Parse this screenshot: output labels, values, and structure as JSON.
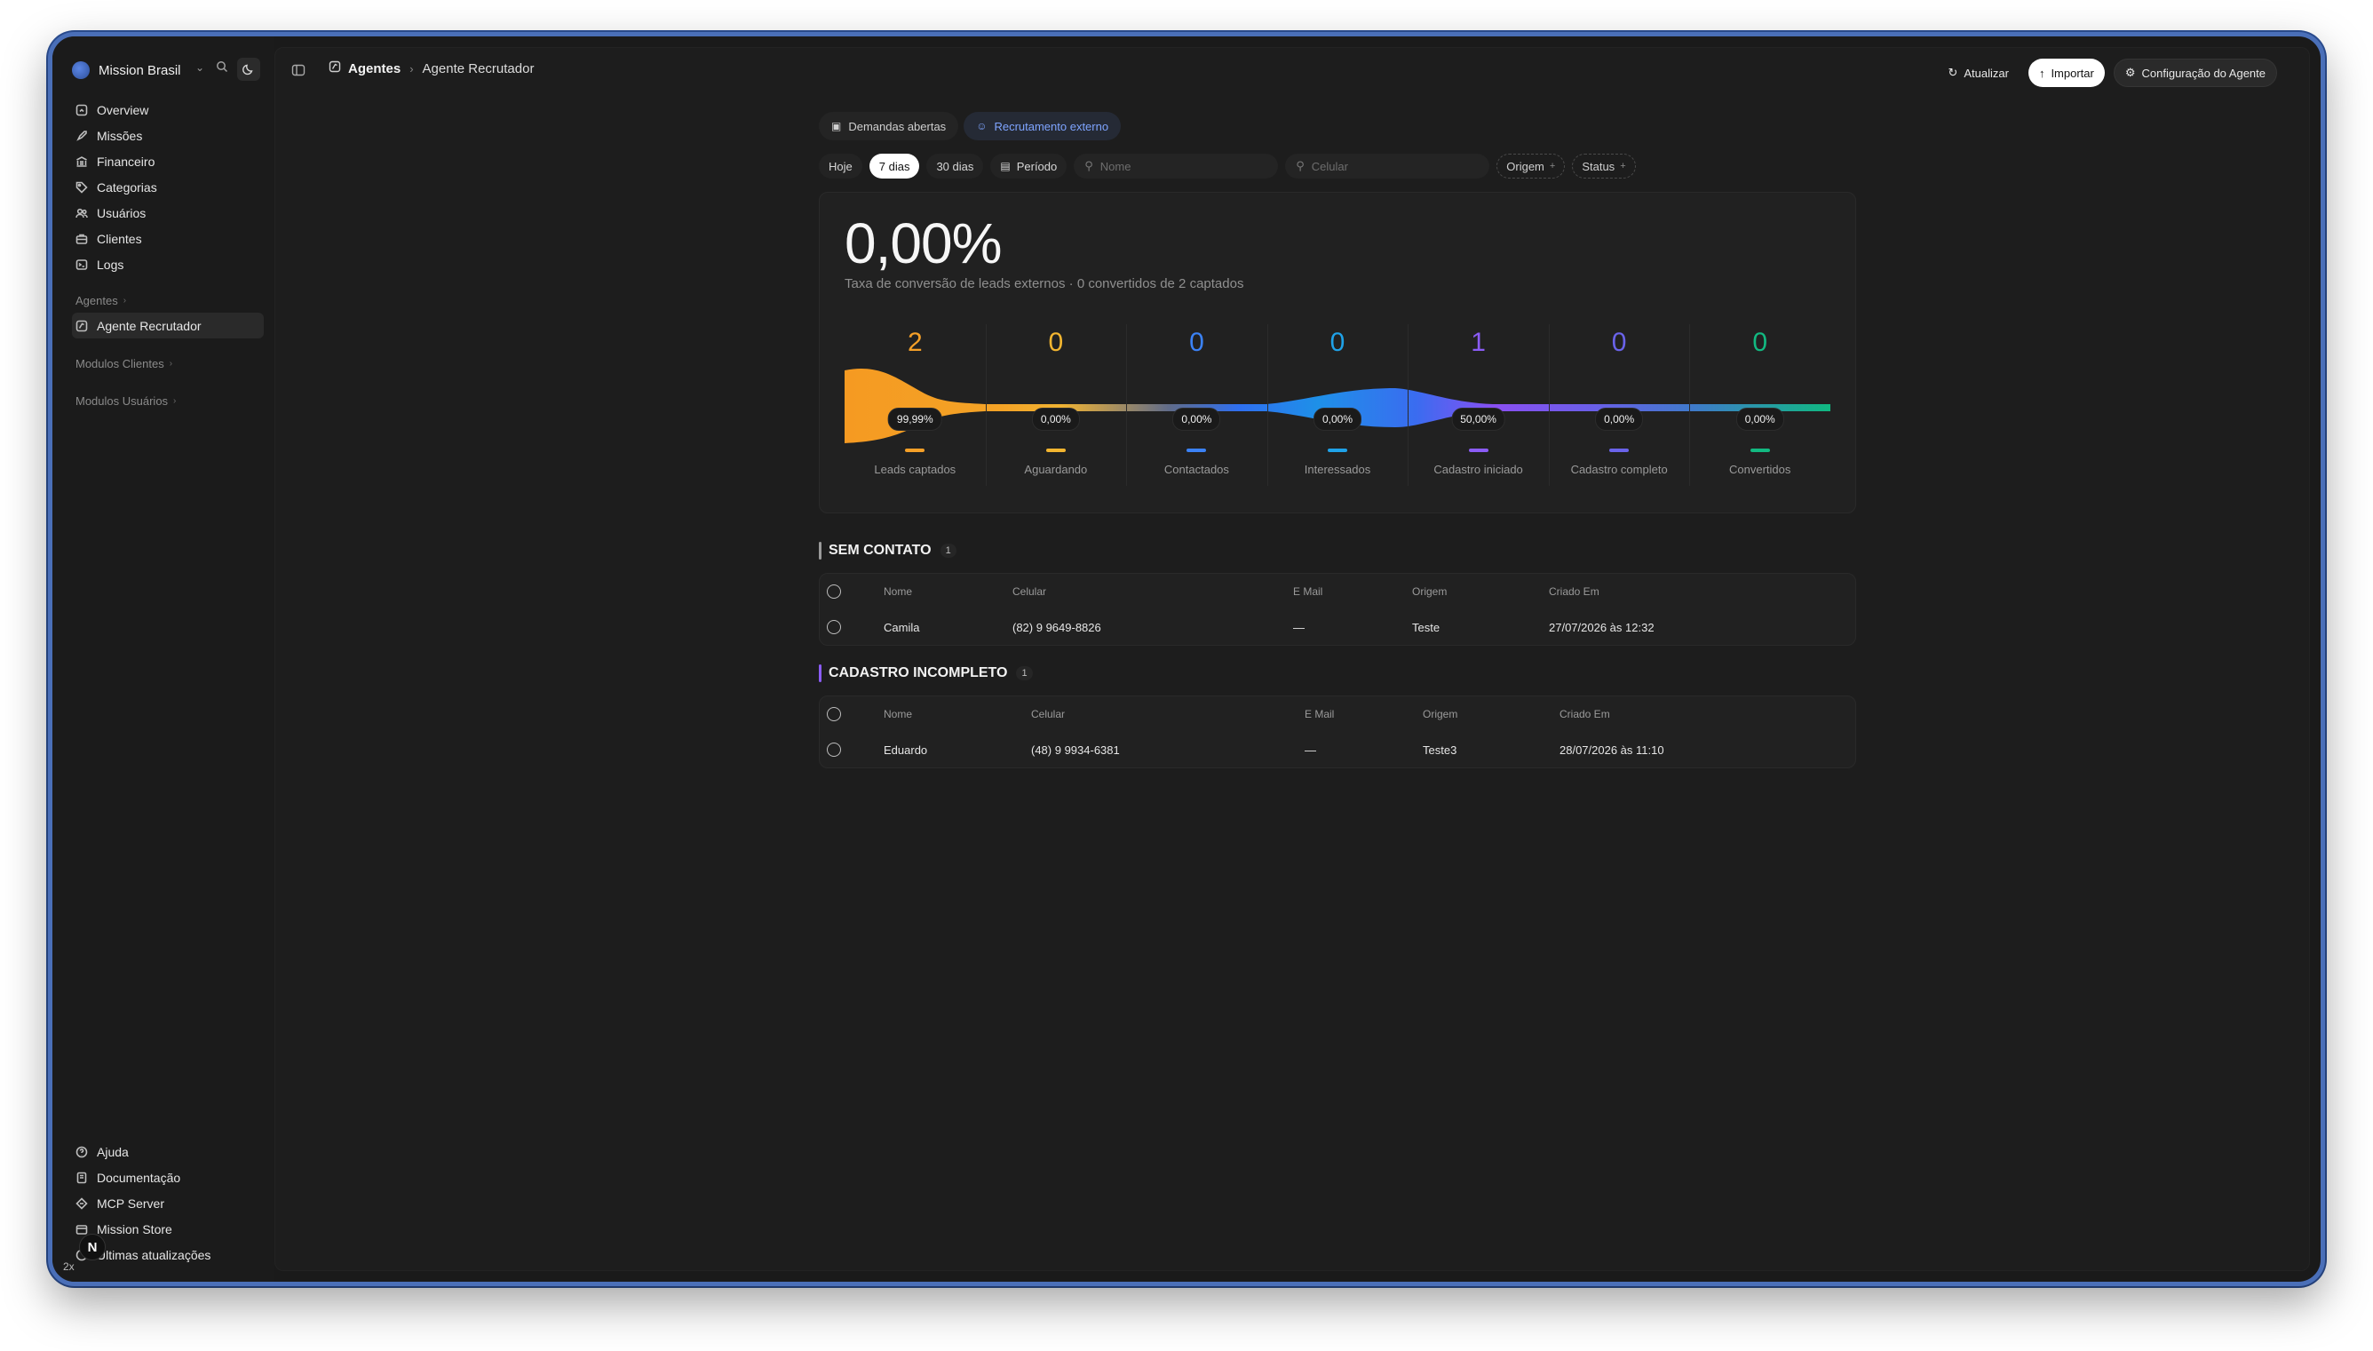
{
  "workspace": {
    "name": "Mission Brasil"
  },
  "sidebar": {
    "main_items": [
      {
        "label": "Overview",
        "icon": "overview-icon"
      },
      {
        "label": "Missões",
        "icon": "rocket-icon"
      },
      {
        "label": "Financeiro",
        "icon": "bank-icon"
      },
      {
        "label": "Categorias",
        "icon": "tag-icon"
      },
      {
        "label": "Usuários",
        "icon": "users-icon"
      },
      {
        "label": "Clientes",
        "icon": "briefcase-icon"
      },
      {
        "label": "Logs",
        "icon": "logs-icon"
      }
    ],
    "agentes_label": "Agentes",
    "agent_items": [
      {
        "label": "Agente Recrutador",
        "icon": "agent-icon"
      }
    ],
    "modulos_clientes_label": "Modulos Clientes",
    "modulos_usuarios_label": "Modulos Usuários",
    "footer_items": [
      {
        "label": "Ajuda",
        "icon": "help-icon"
      },
      {
        "label": "Documentação",
        "icon": "book-icon"
      },
      {
        "label": "MCP Server",
        "icon": "server-icon"
      },
      {
        "label": "Mission Store",
        "icon": "store-icon"
      },
      {
        "label": "Últimas atualizações",
        "icon": "updates-icon"
      }
    ],
    "avatar_initial": "N",
    "zoom_badge": "2x"
  },
  "header": {
    "breadcrumb_root": "Agentes",
    "breadcrumb_current": "Agente Recrutador",
    "refresh_label": "Atualizar",
    "import_label": "Importar",
    "config_label": "Configuração do Agente"
  },
  "tabs": [
    {
      "label": "Demandas abertas",
      "selected": false
    },
    {
      "label": "Recrutamento externo",
      "selected": true
    }
  ],
  "filters": {
    "ranges": [
      {
        "label": "Hoje",
        "selected": false
      },
      {
        "label": "7 dias",
        "selected": true
      },
      {
        "label": "30 dias",
        "selected": false
      }
    ],
    "period_label": "Período",
    "name_placeholder": "Nome",
    "phone_placeholder": "Celular",
    "origin_label": "Origem",
    "status_label": "Status"
  },
  "funnel": {
    "rate": "0,00%",
    "subtitle": "Taxa de conversão de leads externos · 0 convertidos de 2 captados",
    "stages": [
      {
        "label": "Leads captados",
        "count": "2",
        "pct": "99,99%",
        "color": "#f5a028"
      },
      {
        "label": "Aguardando",
        "count": "0",
        "pct": "0,00%",
        "color": "#f2b530"
      },
      {
        "label": "Contactados",
        "count": "0",
        "pct": "0,00%",
        "color": "#3b82f6"
      },
      {
        "label": "Interessados",
        "count": "0",
        "pct": "0,00%",
        "color": "#1fa2e8"
      },
      {
        "label": "Cadastro iniciado",
        "count": "1",
        "pct": "50,00%",
        "color": "#8b5cf6"
      },
      {
        "label": "Cadastro completo",
        "count": "0",
        "pct": "0,00%",
        "color": "#6a63ea"
      },
      {
        "label": "Convertidos",
        "count": "0",
        "pct": "0,00%",
        "color": "#12b981"
      }
    ]
  },
  "sections": [
    {
      "title": "SEM CONTATO",
      "count": "1",
      "stripe": "#9a9a9a",
      "columns": [
        "Nome",
        "Celular",
        "E Mail",
        "Origem",
        "Criado Em"
      ],
      "rows": [
        [
          "Camila",
          "(82) 9 9649-8826",
          "—",
          "Teste",
          "27/07/2026 às 12:32"
        ]
      ]
    },
    {
      "title": "CADASTRO INCOMPLETO",
      "count": "1",
      "stripe": "#8b5cf6",
      "columns": [
        "Nome",
        "Celular",
        "E Mail",
        "Origem",
        "Criado Em"
      ],
      "rows": [
        [
          "Eduardo",
          "(48) 9 9934-6381",
          "—",
          "Teste3",
          "28/07/2026 às 11:10"
        ]
      ]
    }
  ]
}
